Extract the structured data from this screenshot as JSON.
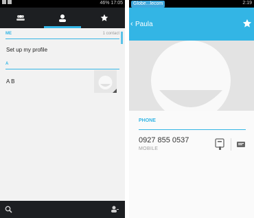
{
  "left": {
    "status_time": "17:05",
    "status_battery": "46%",
    "section_me": "ME",
    "section_me_right": "1 contact",
    "profile_row": "Set up my profile",
    "section_a": "A",
    "contact_row": "A B"
  },
  "right": {
    "status_carrier": "Globe...lecom",
    "status_time": "2:19",
    "contact_name": "Paula",
    "phone_section": "PHONE",
    "phone_number": "0927 855 0537",
    "phone_type": "MOBILE"
  },
  "colors": {
    "accent": "#33b5e5",
    "dark_bar": "#1d1f22"
  },
  "icons": {
    "tab_groups": "groups-icon",
    "tab_contacts": "person-icon",
    "tab_favorites": "star-icon",
    "search": "search-icon",
    "add_contact": "add-contact-icon",
    "favorite": "star-icon",
    "message": "message-icon"
  }
}
